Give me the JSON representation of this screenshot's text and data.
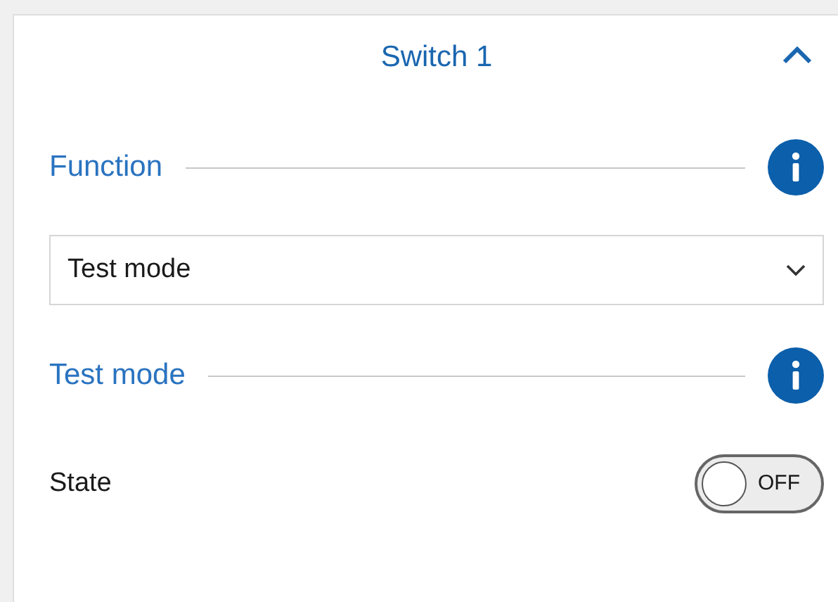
{
  "panel": {
    "title": "Switch 1",
    "expanded": true
  },
  "sections": [
    {
      "kind": "dropdown",
      "heading": "Function",
      "value": "Test mode"
    },
    {
      "kind": "toggle",
      "heading": "Test mode",
      "label": "State",
      "on": false,
      "toggle_text": "OFF"
    }
  ]
}
